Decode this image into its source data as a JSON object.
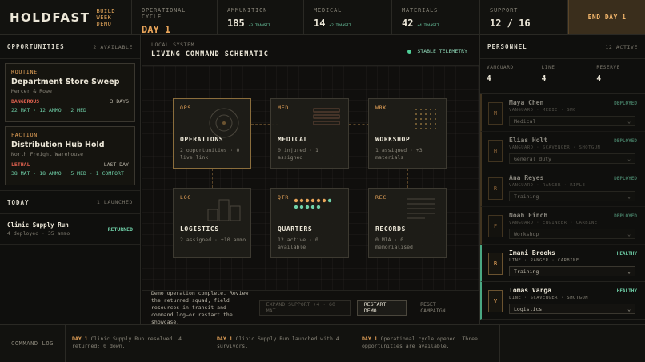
{
  "brand": {
    "name": "HOLDFAST",
    "sub1": "BUILD WEEK",
    "sub2": "DEMO"
  },
  "stats": [
    {
      "label": "OPERATIONAL CYCLE",
      "value": "DAY 1",
      "transit": "",
      "accent": true
    },
    {
      "label": "AMMUNITION",
      "value": "185",
      "transit": "+3 TRANSIT"
    },
    {
      "label": "MEDICAL",
      "value": "14",
      "transit": "+2 TRANSIT"
    },
    {
      "label": "MATERIALS",
      "value": "42",
      "transit": "+4 TRANSIT"
    },
    {
      "label": "SUPPORT",
      "value": "12 / 16",
      "transit": ""
    }
  ],
  "end_day_label": "END DAY 1",
  "opportunities": {
    "title": "OPPORTUNITIES",
    "meta": "2 AVAILABLE",
    "cards": [
      {
        "type": "ROUTINE",
        "title": "Department Store Sweep",
        "place": "Mercer & Rowe",
        "risk": "DANGEROUS",
        "time": "3 DAYS",
        "yield": "22 MAT · 12 AMMO · 2 MED"
      },
      {
        "type": "FACTION",
        "title": "Distribution Hub Hold",
        "place": "North Freight Warehouse",
        "risk": "LETHAL",
        "time": "LAST DAY",
        "yield": "38 MAT · 18 AMMO · 5 MED · 1 COMFORT"
      }
    ]
  },
  "today": {
    "title": "TODAY",
    "meta": "1 LAUNCHED",
    "items": [
      {
        "name": "Clinic Supply Run",
        "sub": "4 deployed · 35 ammo",
        "status": "RETURNED"
      }
    ]
  },
  "center": {
    "local": "LOCAL SYSTEM",
    "title": "LIVING COMMAND SCHEMATIC",
    "telemetry": "STABLE TELEMETRY",
    "rooms": [
      {
        "code": "OPS",
        "name": "OPERATIONS",
        "desc": "2 opportunities · 0 live link"
      },
      {
        "code": "MED",
        "name": "MEDICAL",
        "desc": "0 injured · 1 assigned"
      },
      {
        "code": "WRK",
        "name": "WORKSHOP",
        "desc": "1 assigned · +3 materials"
      },
      {
        "code": "LOG",
        "name": "LOGISTICS",
        "desc": "2 assigned · +10 ammo"
      },
      {
        "code": "QTR",
        "name": "QUARTERS",
        "desc": "12 active · 0 available"
      },
      {
        "code": "REC",
        "name": "RECORDS",
        "desc": "0 MIA · 0 memorialised"
      }
    ],
    "footer_msg": "Demo operation complete. Review the returned squad, field resources in transit and command log—or restart the showcase.",
    "btn_expand": "EXPAND SUPPORT +4 · 60 MAT",
    "btn_restart": "RESTART DEMO",
    "btn_reset": "RESET CAMPAIGN"
  },
  "personnel": {
    "title": "PERSONNEL",
    "meta": "12 ACTIVE",
    "counts": [
      {
        "label": "VANGUARD",
        "value": "4"
      },
      {
        "label": "LINE",
        "value": "4"
      },
      {
        "label": "RESERVE",
        "value": "4"
      }
    ],
    "people": [
      {
        "initial": "M",
        "name": "Maya Chen",
        "tags": "VANGUARD · MEDIC · SMG",
        "status": "DEPLOYED",
        "assignment": "Medical"
      },
      {
        "initial": "H",
        "name": "Elias Holt",
        "tags": "VANGUARD · SCAVENGER · SHOTGUN",
        "status": "DEPLOYED",
        "assignment": "General duty"
      },
      {
        "initial": "R",
        "name": "Ana Reyes",
        "tags": "VANGUARD · RANGER · RIFLE",
        "status": "DEPLOYED",
        "assignment": "Training"
      },
      {
        "initial": "F",
        "name": "Noah Finch",
        "tags": "VANGUARD · ENGINEER · CARBINE",
        "status": "DEPLOYED",
        "assignment": "Workshop"
      },
      {
        "initial": "B",
        "name": "Imani Brooks",
        "tags": "LINE · RANGER · CARBINE",
        "status": "HEALTHY",
        "assignment": "Training"
      },
      {
        "initial": "V",
        "name": "Tomas Varga",
        "tags": "LINE · SCAVENGER · SHOTGUN",
        "status": "HEALTHY",
        "assignment": "Logistics"
      }
    ]
  },
  "log": {
    "label": "COMMAND LOG",
    "entries": [
      {
        "day": "DAY 1",
        "text": "Clinic Supply Run resolved. 4 returned; 0 down."
      },
      {
        "day": "DAY 1",
        "text": "Clinic Supply Run launched with 4 survivors."
      },
      {
        "day": "DAY 1",
        "text": "Operational cycle opened. Three opportunities are available."
      }
    ]
  }
}
